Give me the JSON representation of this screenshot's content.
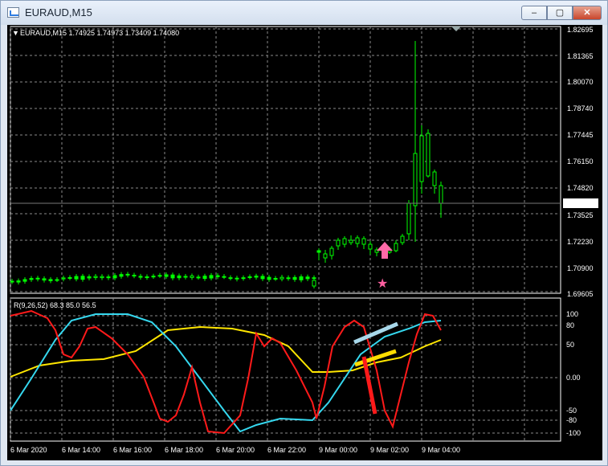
{
  "window": {
    "title": "EURAUD,M15"
  },
  "chart": {
    "header": "EURAUD,M15  1.74925 1.74973 1.73409 1.74080",
    "price_labels": [
      "1.82695",
      "1.81365",
      "1.80070",
      "1.78740",
      "1.77445",
      "1.76150",
      "1.74820",
      "1.74080",
      "1.73525",
      "1.72230",
      "1.70900",
      "1.69605"
    ],
    "current_price": "1.74080",
    "time_labels": [
      "6 Mar 2020",
      "6 Mar 14:00",
      "6 Mar 16:00",
      "6 Mar 18:00",
      "6 Mar 20:00",
      "6 Mar 22:00",
      "9 Mar 00:00",
      "9 Mar 02:00",
      "9 Mar 04:00"
    ]
  },
  "indicator": {
    "header": "R(9,26,52) 68.3 85.0 56.5",
    "levels": [
      "100",
      "80",
      "50",
      "0.00",
      "-50",
      "-80",
      "-100"
    ]
  },
  "colors": {
    "candle": "#00ff00",
    "grid": "#8a8a8a",
    "line_red": "#ff1a1a",
    "line_cyan": "#35d8ef",
    "line_yellow": "#ffe600",
    "arrow": "#ff6aa8",
    "star": "#ff5fa0",
    "drawn_blue": "#a8d8ea",
    "drawn_yellow": "#ffdd00"
  },
  "icons": {
    "window_icon": "chart-window-icon",
    "arrow": "up-arrow-icon",
    "star": "star-icon"
  }
}
